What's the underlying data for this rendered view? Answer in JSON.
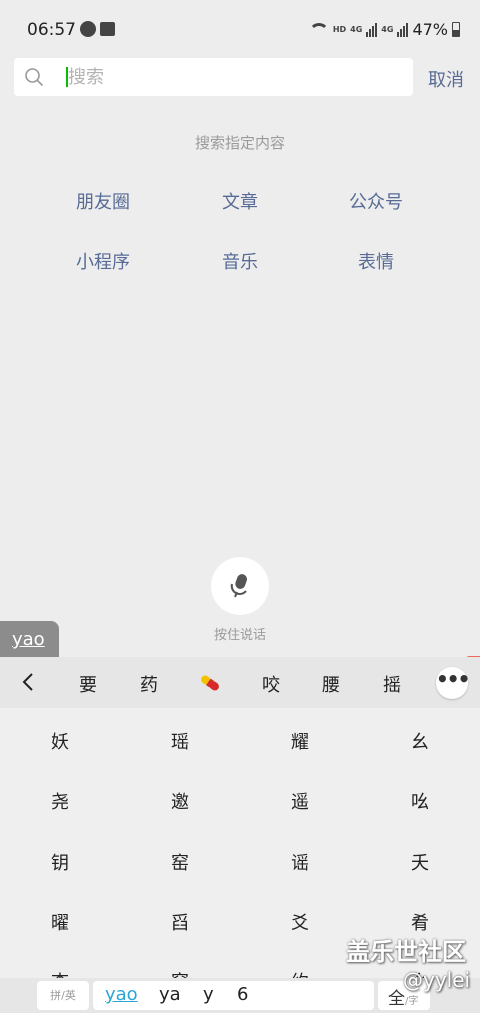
{
  "status_bar": {
    "time": "06:57",
    "network_hd": "HD",
    "network_4g": "4G",
    "network_4g_2": "4G",
    "battery_percent": "47%"
  },
  "search": {
    "placeholder": "搜索",
    "value": "",
    "cancel_label": "取消"
  },
  "section_title": "搜索指定内容",
  "categories": [
    {
      "label": "朋友圈"
    },
    {
      "label": "文章"
    },
    {
      "label": "公众号"
    },
    {
      "label": "小程序"
    },
    {
      "label": "音乐"
    },
    {
      "label": "表情"
    }
  ],
  "voice": {
    "label": "按住说话"
  },
  "ime": {
    "composition": "yao",
    "candidates_top": [
      "要",
      "药",
      "咬",
      "腰",
      "摇"
    ],
    "candidate_grid": [
      [
        "妖",
        "瑶",
        "耀",
        "幺"
      ],
      [
        "尧",
        "邀",
        "遥",
        "吆"
      ],
      [
        "钥",
        "窑",
        "谣",
        "夭"
      ],
      [
        "曜",
        "舀",
        "爻",
        "肴"
      ],
      [
        "杳",
        "窕",
        "约",
        "幺"
      ]
    ],
    "bottom": {
      "pin_en_label": "拼/英",
      "pinyin_options": [
        "yao",
        "ya",
        "y",
        "6"
      ],
      "full_label": "全",
      "full_sub": "/字"
    }
  },
  "watermark": {
    "line1": "盖乐世社区",
    "line2": "@yylei"
  }
}
